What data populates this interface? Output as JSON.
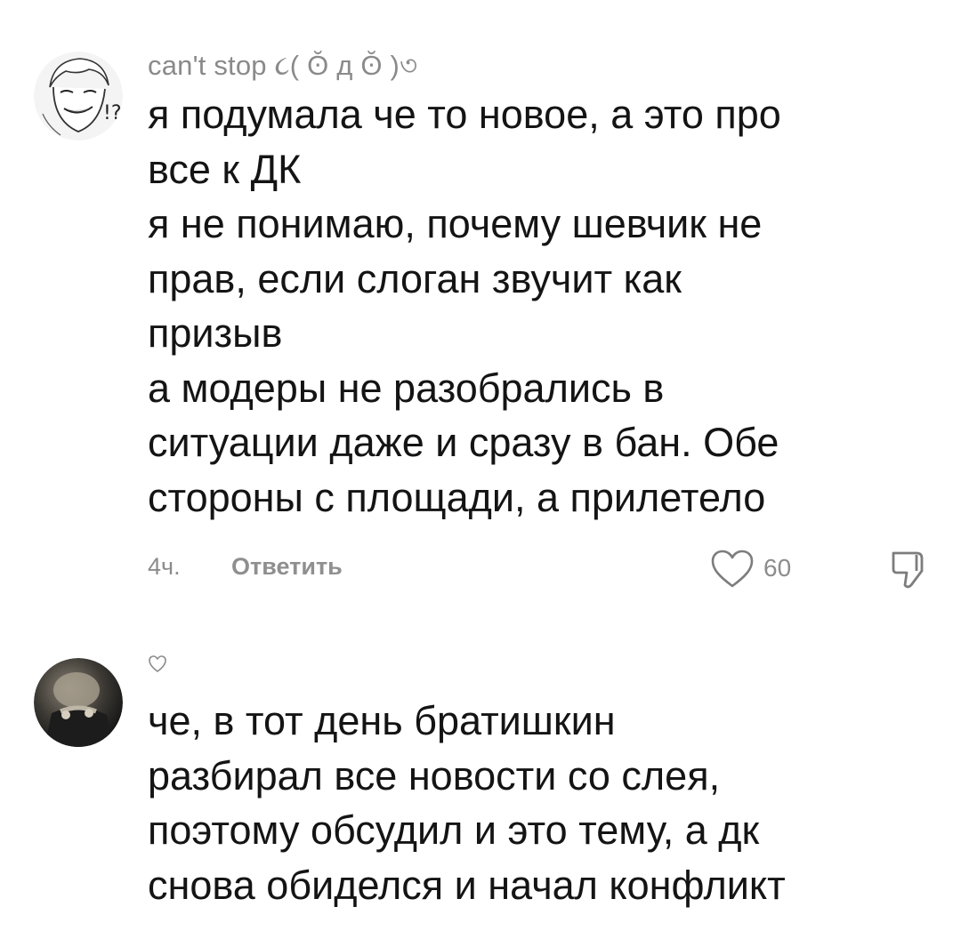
{
  "comments": [
    {
      "username": "can't stop ૮( ʘ̆ д ʘ̆ )৩",
      "text": "я подумала че то новое, а это про\nвсе к ДК\nя не понимаю, почему шевчик не\nправ, если слоган звучит как\nпризыв\nа модеры не разобрались в\nситуации даже и сразу в бан. Обе\nстороны с площади, а прилетело",
      "time": "4ч.",
      "reply_label": "Ответить",
      "likes": "60",
      "avatar_icon": "anime-character-avatar"
    },
    {
      "username": "",
      "username_icon": "heart-outline-icon",
      "text": "че, в тот день братишкин\nразбирал все новости со слея,\nпоэтому обсудил и это тему, а дк\nснова обиделся и начал конфликт",
      "avatar_icon": "dark-photo-avatar"
    }
  ],
  "colors": {
    "text": "#141414",
    "secondary": "#8a8a8a",
    "background": "#ffffff"
  }
}
